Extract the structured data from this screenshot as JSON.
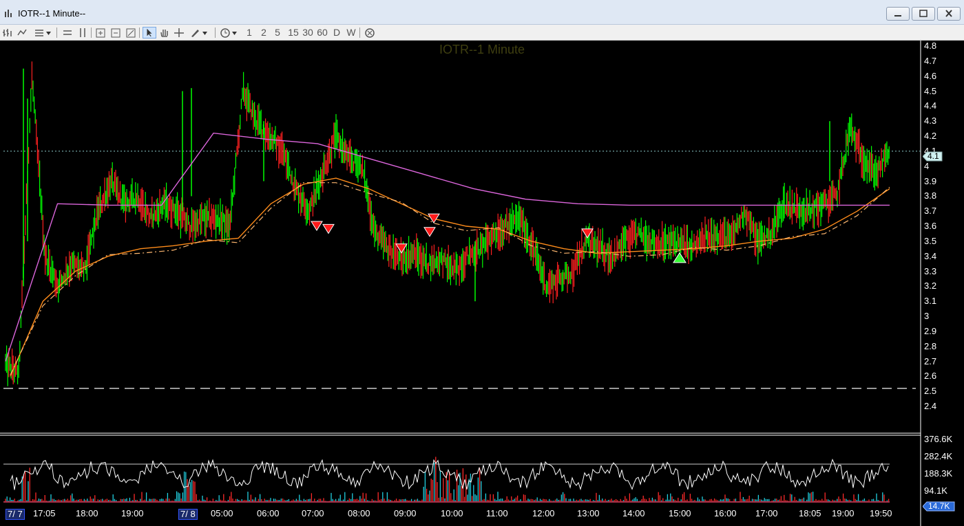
{
  "window": {
    "title": "IOTR--1 Minute--",
    "controls": [
      "minimize",
      "maximize",
      "close"
    ]
  },
  "toolbar": {
    "intervals": [
      "1",
      "2",
      "5",
      "15",
      "30",
      "60",
      "D",
      "W"
    ]
  },
  "chart": {
    "title": "IOTR--1 Minute",
    "current_price_label": "4.1",
    "volume_last_label": "14.7K"
  },
  "colors": {
    "background": "#000000",
    "up_bar": "#00ff00",
    "down_bar": "#ff2020",
    "vwap_line": "#dd66dd",
    "ma_line": "#ff8c1a",
    "sell_marker": "#ff1a1a",
    "buy_marker": "#33ff33"
  },
  "chart_data": [
    {
      "type": "line",
      "title": "IOTR--1 Minute",
      "y_axis_ticks": [
        "4.8",
        "4.7",
        "4.6",
        "4.5",
        "4.4",
        "4.3",
        "4.2",
        "4.1",
        "4",
        "3.9",
        "3.8",
        "3.7",
        "3.6",
        "3.5",
        "3.4",
        "3.3",
        "3.2",
        "3.1",
        "3",
        "2.9",
        "2.8",
        "2.7",
        "2.6",
        "2.5",
        "2.4"
      ],
      "x_axis_ticks": [
        "7/ 7",
        "17:05",
        "18:00",
        "19:00",
        "7/ 8",
        "05:00",
        "06:00",
        "07:00",
        "08:00",
        "09:00",
        "10:00",
        "11:00",
        "12:00",
        "13:00",
        "14:00",
        "15:00",
        "16:00",
        "17:00",
        "18:05",
        "19:00",
        "19:50"
      ],
      "ylim": [
        2.4,
        4.8
      ],
      "current_price": 4.1,
      "reference_line": 2.52,
      "series": [
        {
          "values": [
            2.68,
            2.62,
            4.6,
            3.4,
            3.2,
            3.35,
            3.3,
            3.7,
            3.9,
            3.75,
            3.8,
            3.65,
            3.75,
            3.7,
            3.6,
            3.65,
            3.65,
            3.6,
            4.5,
            4.3,
            4.2,
            4.1,
            3.85,
            3.7,
            3.95,
            4.2,
            4.05,
            4.0,
            3.55,
            3.45,
            3.38,
            3.42,
            3.35,
            3.38,
            3.3,
            3.4,
            3.45,
            3.55,
            3.6,
            3.65,
            3.45,
            3.2,
            3.25,
            3.3,
            3.5,
            3.45,
            3.4,
            3.5,
            3.55,
            3.5,
            3.48,
            3.5,
            3.45,
            3.52,
            3.55,
            3.52,
            3.7,
            3.5,
            3.55,
            3.75,
            3.72,
            3.7,
            3.75,
            3.8,
            4.25,
            4.05,
            3.95,
            4.1
          ]
        },
        {
          "values": [
            2.6,
            3.1,
            3.3,
            3.4,
            3.45,
            3.47,
            3.5,
            3.52,
            3.75,
            3.88,
            3.92,
            3.85,
            3.75,
            3.65,
            3.6,
            3.58,
            3.5,
            3.45,
            3.42,
            3.43,
            3.44,
            3.45,
            3.47,
            3.5,
            3.52,
            3.58,
            3.7,
            3.85
          ]
        },
        {
          "values": [
            2.7,
            3.75,
            3.74,
            3.74,
            4.22,
            4.18,
            4.15,
            4.05,
            3.95,
            3.85,
            3.78,
            3.75,
            3.74,
            3.74,
            3.74,
            3.74,
            3.74,
            3.74
          ]
        }
      ]
    },
    {
      "type": "bar",
      "y_axis_ticks": [
        "376.6K",
        "282.4K",
        "188.3K",
        "94.1K"
      ],
      "last_value_label": "14.7K",
      "ylim": [
        0,
        376600
      ]
    }
  ]
}
